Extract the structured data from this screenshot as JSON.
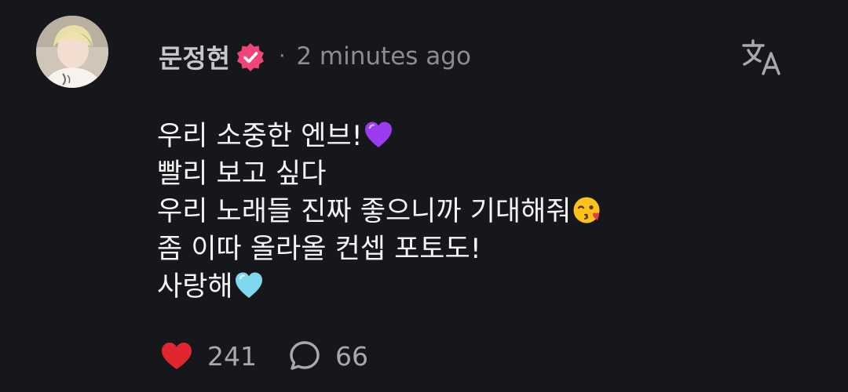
{
  "post": {
    "author": "문정현",
    "separator": "·",
    "time": "2 minutes ago",
    "lines": [
      {
        "text": "우리 소중한 엔브!",
        "emoji": "purple-heart"
      },
      {
        "text": "빨리 보고 싶다",
        "emoji": ""
      },
      {
        "text": "우리 노래들 진짜 좋으니까 기대해줘",
        "emoji": "kissing-face"
      },
      {
        "text": "좀 이따 올라올 컨셉 포토도!",
        "emoji": ""
      },
      {
        "text": "사랑해",
        "emoji": "light-blue-heart"
      }
    ],
    "likes": "241",
    "comments": "66"
  },
  "icons": {
    "verified": "verified-badge-icon",
    "translate": "translate-icon",
    "like": "heart-icon",
    "comment": "comment-bubble-icon"
  },
  "colors": {
    "background": "#16171b",
    "verified": "#f0447a",
    "like": "#e0262f",
    "text": "#f4f4f4",
    "muted": "#8c8c92"
  }
}
